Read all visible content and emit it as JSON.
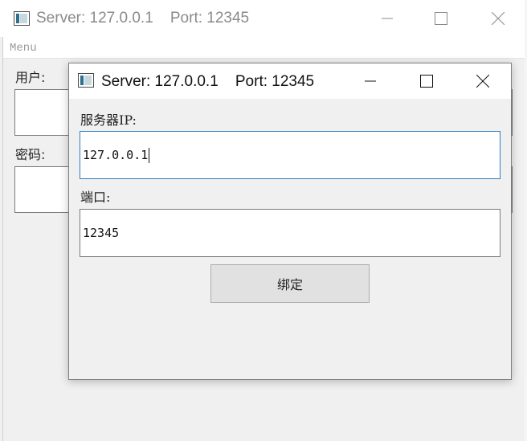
{
  "main_window": {
    "title": "Server: 127.0.0.1    Port: 12345",
    "menu_label": "Menu",
    "user_label": "用户:",
    "password_label": "密码:"
  },
  "dialog": {
    "title": "Server: 127.0.0.1    Port: 12345",
    "ip_label": "服务器IP:",
    "ip_value": "127.0.0.1",
    "port_label": "端口:",
    "port_value": "12345",
    "bind_label": "绑定"
  }
}
